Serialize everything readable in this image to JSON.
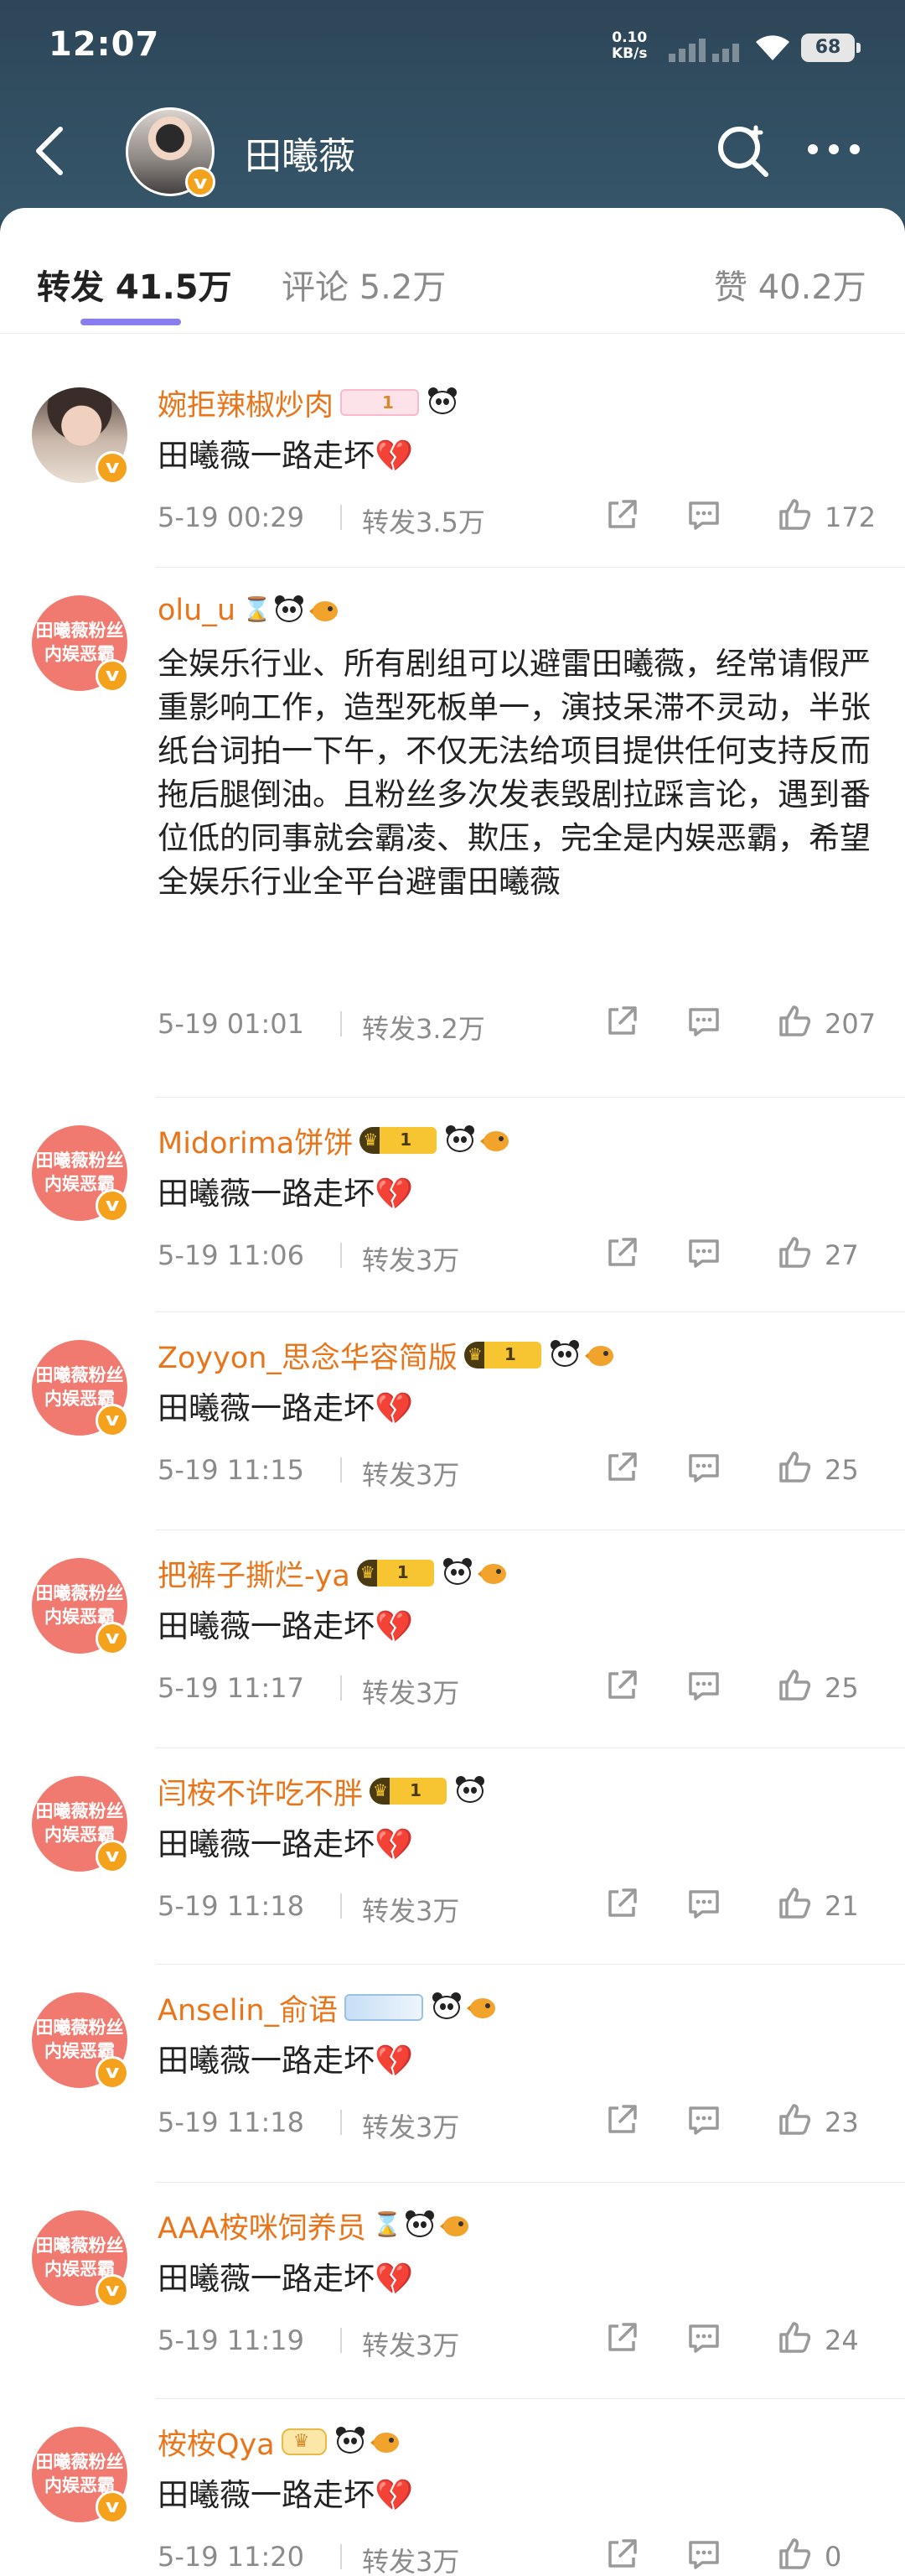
{
  "status": {
    "time": "12:07",
    "net_speed_value": "0.10",
    "net_speed_unit": "KB/s",
    "battery": "68"
  },
  "header": {
    "name": "田曦薇"
  },
  "tabs": [
    {
      "label": "转发 41.5万",
      "active": true
    },
    {
      "label": "评论 5.2万",
      "active": false
    },
    {
      "label": "赞 40.2万",
      "active": false
    }
  ],
  "fan_avatar": {
    "line1": "田曦薇粉丝",
    "line2": "内娱恶霸"
  },
  "comments": [
    {
      "name": "婉拒辣椒炒肉",
      "badges": [
        "pinkmember",
        "panda"
      ],
      "text": "田曦薇一路走坏",
      "heart": "💔",
      "time": "5-19 00:29",
      "repost": "转发3.5万",
      "likes": "172",
      "avatar": "photo"
    },
    {
      "name": "olu_u",
      "badges": [
        "hourglass",
        "panda",
        "fish"
      ],
      "text": "全娱乐行业、所有剧组可以避雷田曦薇，经常请假严重影响工作，造型死板单一，演技呆滞不灵动，半张纸台词拍一下午，不仅无法给项目提供任何支持反而拖后腿倒油。且粉丝多次发表毁剧拉踩言论，遇到番位低的同事就会霸凌、欺压，完全是内娱恶霸，希望全娱乐行业全平台避雷田曦薇",
      "heart": "",
      "time": "5-19 01:01",
      "repost": "转发3.2万",
      "likes": "207",
      "avatar": "fan"
    },
    {
      "name": "Midorima饼饼",
      "badges": [
        "member",
        "panda",
        "fish"
      ],
      "text": "田曦薇一路走坏",
      "heart": "💔",
      "time": "5-19 11:06",
      "repost": "转发3万",
      "likes": "27",
      "avatar": "fan"
    },
    {
      "name": "Zoyyon_思念华容简版",
      "badges": [
        "member",
        "panda",
        "fish"
      ],
      "text": "田曦薇一路走坏",
      "heart": "💔",
      "time": "5-19 11:15",
      "repost": "转发3万",
      "likes": "25",
      "avatar": "fan"
    },
    {
      "name": "把裤子撕烂-ya",
      "badges": [
        "member",
        "panda",
        "fish"
      ],
      "text": "田曦薇一路走坏",
      "heart": "💔",
      "time": "5-19 11:17",
      "repost": "转发3万",
      "likes": "25",
      "avatar": "fan"
    },
    {
      "name": "闫桉不许吃不胖",
      "badges": [
        "member",
        "panda"
      ],
      "text": "田曦薇一路走坏",
      "heart": "💔",
      "time": "5-19 11:18",
      "repost": "转发3万",
      "likes": "21",
      "avatar": "fan"
    },
    {
      "name": "Anselin_俞语",
      "badges": [
        "bluemember",
        "panda",
        "fish"
      ],
      "text": "田曦薇一路走坏",
      "heart": "💔",
      "time": "5-19 11:18",
      "repost": "转发3万",
      "likes": "23",
      "avatar": "fan"
    },
    {
      "name": "AAA桉咪饲养员",
      "badges": [
        "hourglass",
        "panda",
        "fish"
      ],
      "text": "田曦薇一路走坏",
      "heart": "💔",
      "time": "5-19 11:19",
      "repost": "转发3万",
      "likes": "24",
      "avatar": "fan"
    },
    {
      "name": "桉桉Qya",
      "badges": [
        "crown",
        "panda",
        "fish"
      ],
      "text": "田曦薇一路走坏",
      "heart": "💔",
      "time": "5-19 11:20",
      "repost": "转发3万",
      "likes": "0",
      "avatar": "fan"
    }
  ],
  "icons": {
    "back": "back-arrow-icon",
    "search": "search-icon",
    "more": "more-icon",
    "share": "share-icon",
    "comment": "comment-icon",
    "like": "like-icon",
    "verified": "verified-v-icon"
  },
  "colors": {
    "header_bg": "#2d4658",
    "username": "#e8751a",
    "accent_underline": "#8a7df0",
    "fan_avatar_bg": "#f07a70",
    "verified": "#f4a21b"
  }
}
